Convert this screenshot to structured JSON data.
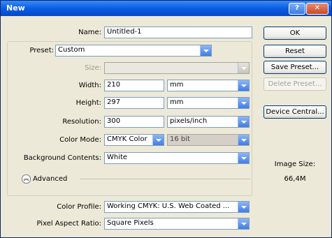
{
  "window": {
    "title": "New"
  },
  "form": {
    "name": {
      "label": "Name:",
      "value": "Untitled-1"
    },
    "preset": {
      "label": "Preset:",
      "value": "Custom"
    },
    "size": {
      "label": "Size:",
      "value": ""
    },
    "width": {
      "label": "Width:",
      "value": "210",
      "unit": "mm"
    },
    "height": {
      "label": "Height:",
      "value": "297",
      "unit": "mm"
    },
    "resolution": {
      "label": "Resolution:",
      "value": "300",
      "unit": "pixels/inch"
    },
    "color_mode": {
      "label": "Color Mode:",
      "value": "CMYK Color",
      "depth": "16 bit"
    },
    "background": {
      "label": "Background Contents:",
      "value": "White"
    },
    "advanced": {
      "label": "Advanced"
    },
    "color_profile": {
      "label": "Color Profile:",
      "value": "Working CMYK:  U.S. Web Coated ..."
    },
    "pixel_aspect": {
      "label": "Pixel Aspect Ratio:",
      "value": "Square Pixels"
    }
  },
  "buttons": {
    "ok": "OK",
    "reset": "Reset",
    "save_preset": "Save Preset...",
    "delete_preset": "Delete Preset...",
    "device_central": "Device Central..."
  },
  "info": {
    "image_size_label": "Image Size:",
    "image_size_value": "66,4M"
  }
}
